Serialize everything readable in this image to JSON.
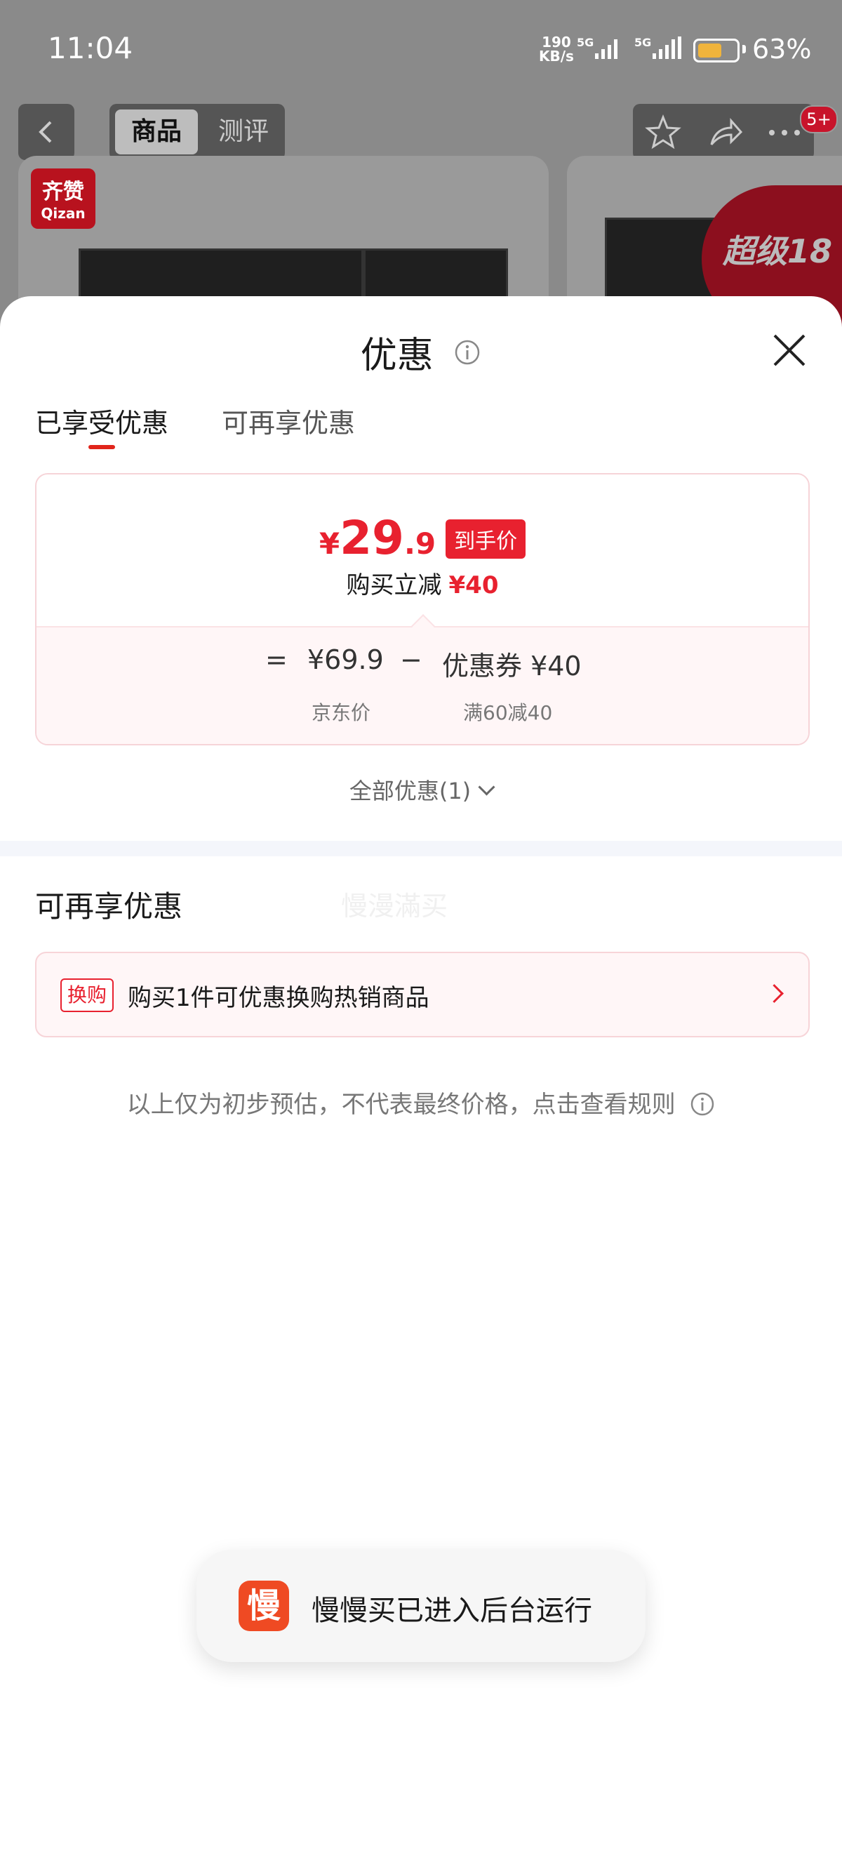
{
  "status_bar": {
    "time": "11:04",
    "net_speed_value": "190",
    "net_speed_unit": "KB/s",
    "network_1": "5G",
    "network_2": "5G",
    "battery_percent": 63,
    "battery_label": "63%"
  },
  "background_page": {
    "tab_product": "商品",
    "tab_review": "测评",
    "badge": "5+",
    "brand_logo_cn": "齐赞",
    "brand_logo_en": "Qizan",
    "promo_text": "超级18"
  },
  "sheet": {
    "title": "优惠",
    "tabs": [
      {
        "label": "已享受优惠",
        "active": true
      },
      {
        "label": "可再享优惠",
        "active": false
      }
    ],
    "final_price": {
      "currency": "¥",
      "integer": "29",
      "decimal": ".9",
      "tag": "到手价"
    },
    "reduce_line": {
      "label": "购买立减",
      "amount": "¥40"
    },
    "formula": {
      "equals": "=",
      "jd_price": "¥69.9",
      "jd_price_label": "京东价",
      "minus": "−",
      "coupon": "优惠券 ¥40",
      "coupon_label": "满60减40"
    },
    "all_discounts": "全部优惠(1)",
    "more_section_title": "可再享优惠",
    "watermark": "慢漫滿买",
    "exchange": {
      "tag": "换购",
      "text": "购买1件可优惠换购热销商品"
    },
    "disclaimer": "以上仅为初步预估，不代表最终价格，点击查看规则"
  },
  "toast": {
    "icon_char": "慢",
    "text": "慢慢买已进入后台运行"
  },
  "colors": {
    "accent_red": "#e8212f",
    "toast_icon": "#ef4a23",
    "divider": "#f4f6fb"
  }
}
